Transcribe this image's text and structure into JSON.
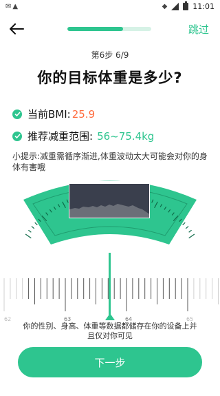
{
  "status_bar": {
    "time": "11:01",
    "icons": [
      "gmail-icon",
      "warning-icon",
      "wifi-icon",
      "signal-icon",
      "battery-icon"
    ]
  },
  "header": {
    "skip_label": "跳过",
    "progress": 0.66
  },
  "step": {
    "label": "第6步 6/9"
  },
  "title": "你的目标体重是多少?",
  "info": {
    "bmi_label": "当前BMI:",
    "bmi_value": "25.9",
    "range_label": "推荐减重范围:",
    "range_value": "56~75.4kg"
  },
  "tip": "小提示:减重需循序渐进,体重波动太大可能会对你的身体有害哦",
  "ruler": {
    "labels": [
      "62",
      "63",
      "64",
      "65"
    ],
    "selected": "64"
  },
  "privacy_note": "你的性别、身高、体重等数据都储存在你的设备上并且仅对你可见",
  "next_button_label": "下一步",
  "colors": {
    "accent": "#2ec58f",
    "bmi": "#ff6b3d"
  }
}
